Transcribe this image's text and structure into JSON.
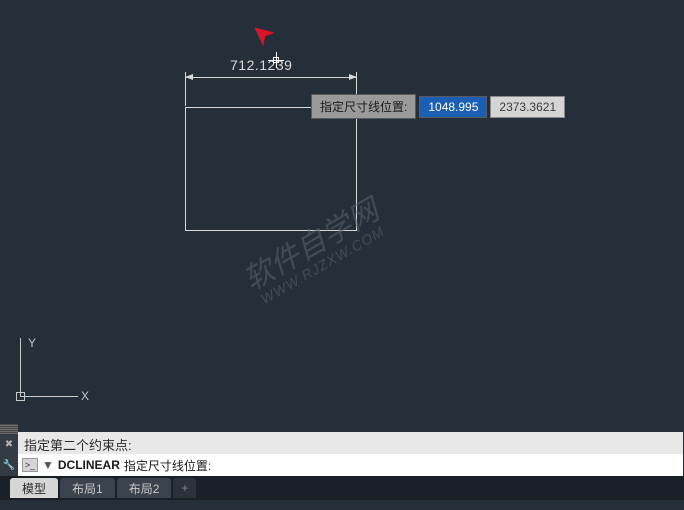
{
  "canvas": {
    "dimension_text": "712.1239",
    "tooltip": {
      "label": "指定尺寸线位置:",
      "active_value": "1048.995",
      "secondary_value": "2373.3621"
    },
    "ucs": {
      "x_label": "X",
      "y_label": "Y"
    },
    "watermark": {
      "line1": "软件自学网",
      "line2": "WWW.RJZXW.COM"
    }
  },
  "command": {
    "history": "指定第二个约束点:",
    "prompt_icon": ">_",
    "dash": "▼",
    "command_name": "DCLINEAR",
    "prompt_text": "指定尺寸线位置:"
  },
  "tabs": {
    "items": [
      {
        "label": "模型",
        "active": true
      },
      {
        "label": "布局1",
        "active": false
      },
      {
        "label": "布局2",
        "active": false
      }
    ],
    "plus": "+"
  },
  "sidebar": {
    "icon1": "✖",
    "icon2": "🔧"
  }
}
